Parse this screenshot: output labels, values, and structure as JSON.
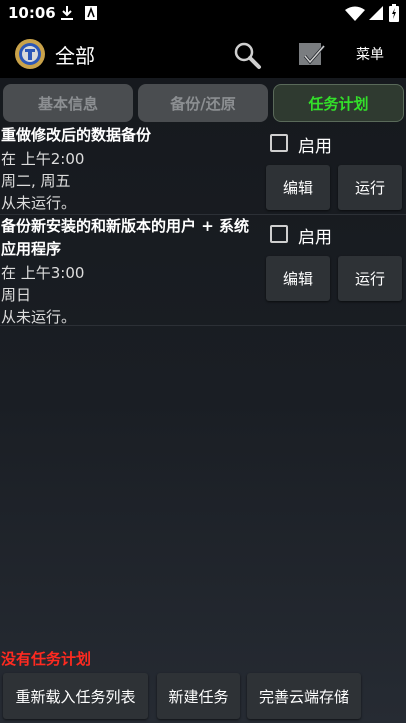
{
  "status_bar": {
    "time": "10:06"
  },
  "app_bar": {
    "title": "全部",
    "menu_label": "菜单"
  },
  "tabs": [
    {
      "label": "基本信息",
      "active": false
    },
    {
      "label": "备份/还原",
      "active": false
    },
    {
      "label": "任务计划",
      "active": true
    }
  ],
  "tasks": [
    {
      "name": "重做修改后的数据备份",
      "time": "在 上午2:00",
      "days": "周二, 周五",
      "last_run": "从未运行。",
      "enable_label": "启用",
      "enabled": false,
      "edit_label": "编辑",
      "run_label": "运行"
    },
    {
      "name_line1": "备份新安装的和新版本的用户 + 系统",
      "name_line2": "应用程序",
      "time": "在 上午3:00",
      "days": "周日",
      "last_run": "从未运行。",
      "enable_label": "启用",
      "enabled": false,
      "edit_label": "编辑",
      "run_label": "运行"
    }
  ],
  "empty_message": "没有任务计划",
  "bottom_buttons": {
    "reload": "重新载入任务列表",
    "new_task": "新建任务",
    "cloud": "完善云端存储"
  },
  "colors": {
    "active_tab": "#33e02a",
    "warning": "#ff2a20"
  }
}
